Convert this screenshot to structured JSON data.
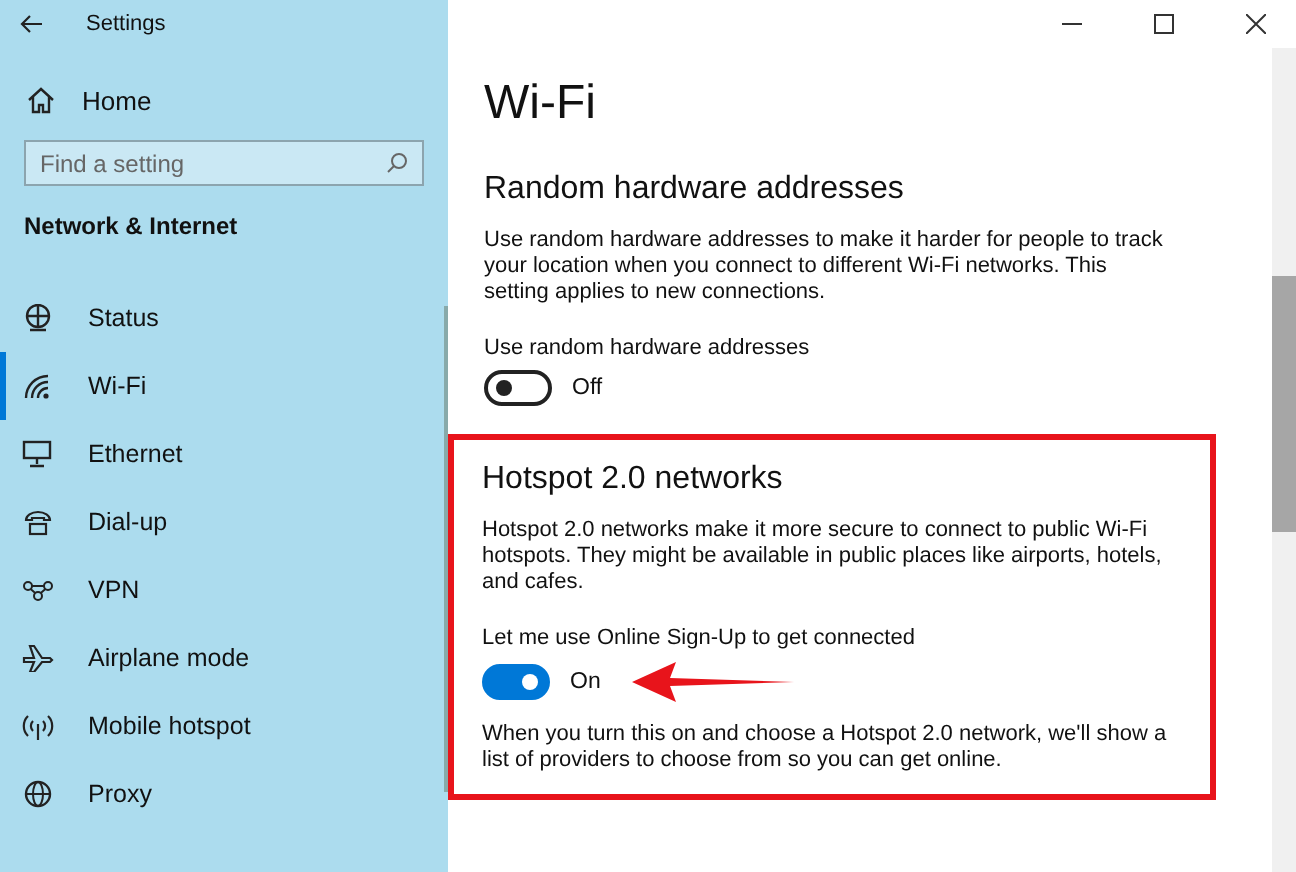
{
  "window": {
    "title": "Settings"
  },
  "sidebar": {
    "home": "Home",
    "search": {
      "placeholder": "Find a setting"
    },
    "section": "Network & Internet",
    "items": [
      {
        "label": "Status",
        "kind": "status",
        "selected": false
      },
      {
        "label": "Wi-Fi",
        "kind": "wifi",
        "selected": true
      },
      {
        "label": "Ethernet",
        "kind": "ethernet",
        "selected": false
      },
      {
        "label": "Dial-up",
        "kind": "dialup",
        "selected": false
      },
      {
        "label": "VPN",
        "kind": "vpn",
        "selected": false
      },
      {
        "label": "Airplane mode",
        "kind": "airplane",
        "selected": false
      },
      {
        "label": "Mobile hotspot",
        "kind": "hotspot",
        "selected": false
      },
      {
        "label": "Proxy",
        "kind": "proxy",
        "selected": false
      }
    ]
  },
  "page": {
    "title": "Wi-Fi",
    "sections": [
      {
        "heading": "Random hardware addresses",
        "highlighted": false,
        "description": "Use random hardware addresses to make it harder for people to track your location when you connect to different Wi-Fi networks. This setting applies to new connections.",
        "toggle": {
          "label": "Use random hardware addresses",
          "on": false,
          "state": "Off"
        }
      },
      {
        "heading": "Hotspot 2.0 networks",
        "highlighted": true,
        "description": "Hotspot 2.0 networks make it more secure to connect to public Wi-Fi hotspots. They might be available in public places like airports, hotels, and cafes.",
        "toggle": {
          "label": "Let me use Online Sign-Up to get connected",
          "on": true,
          "state": "On"
        },
        "note": "When you turn this on and choose a Hotspot 2.0 network, we'll show a list of providers to choose from so you can get online."
      }
    ]
  }
}
